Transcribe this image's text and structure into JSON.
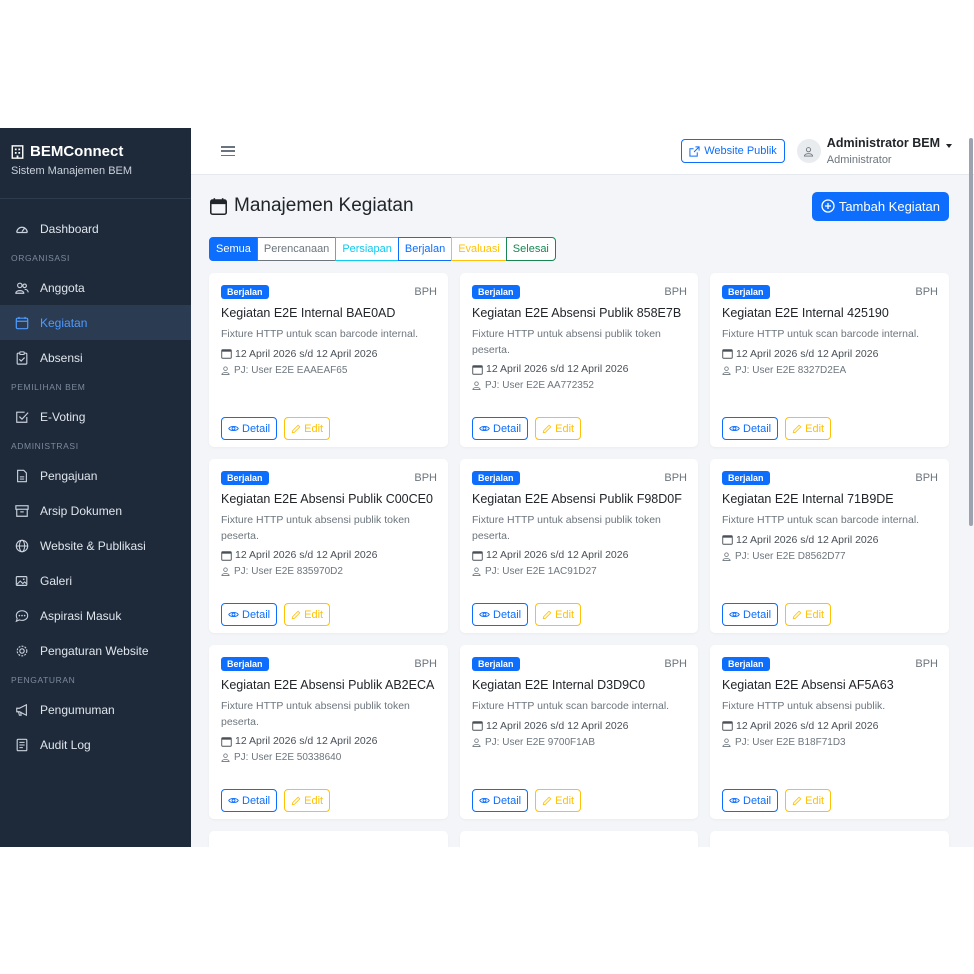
{
  "brand": {
    "name": "BEMConnect",
    "subtitle": "Sistem Manajemen BEM"
  },
  "sidebar": {
    "dashboard": "Dashboard",
    "sec_organisasi": "ORGANISASI",
    "anggota": "Anggota",
    "kegiatan": "Kegiatan",
    "absensi": "Absensi",
    "sec_pemilihan": "PEMILIHAN BEM",
    "evoting": "E-Voting",
    "sec_administrasi": "ADMINISTRASI",
    "pengajuan": "Pengajuan",
    "arsip": "Arsip Dokumen",
    "website": "Website & Publikasi",
    "galeri": "Galeri",
    "aspirasi": "Aspirasi Masuk",
    "pengaturan_web": "Pengaturan Website",
    "sec_pengaturan": "PENGATURAN",
    "pengumuman": "Pengumuman",
    "audit": "Audit Log"
  },
  "topbar": {
    "public_label": "Website Publik",
    "user_name": "Administrator BEM",
    "user_role": "Administrator"
  },
  "page": {
    "title": "Manajemen Kegiatan",
    "add_label": "Tambah Kegiatan"
  },
  "filters": [
    {
      "label": "Semua",
      "color": "#0d6efd",
      "active": true
    },
    {
      "label": "Perencanaan",
      "color": "#6c757d"
    },
    {
      "label": "Persiapan",
      "color": "#0dcaf0"
    },
    {
      "label": "Berjalan",
      "color": "#0d6efd"
    },
    {
      "label": "Evaluasi",
      "color": "#ffc107"
    },
    {
      "label": "Selesai",
      "color": "#198754"
    }
  ],
  "cards": [
    {
      "status": "Berjalan",
      "unit": "BPH",
      "title": "Kegiatan E2E Internal BAE0AD",
      "desc": "Fixture HTTP untuk scan barcode internal.",
      "date": "12 April 2026 s/d 12 April 2026",
      "pj": "PJ: User E2E EAAEAF65",
      "detail": "Detail",
      "edit": "Edit"
    },
    {
      "status": "Berjalan",
      "unit": "BPH",
      "title": "Kegiatan E2E Absensi Publik 858E7B",
      "desc": "Fixture HTTP untuk absensi publik token peserta.",
      "date": "12 April 2026 s/d 12 April 2026",
      "pj": "PJ: User E2E AA772352",
      "detail": "Detail",
      "edit": "Edit"
    },
    {
      "status": "Berjalan",
      "unit": "BPH",
      "title": "Kegiatan E2E Internal 425190",
      "desc": "Fixture HTTP untuk scan barcode internal.",
      "date": "12 April 2026 s/d 12 April 2026",
      "pj": "PJ: User E2E 8327D2EA",
      "detail": "Detail",
      "edit": "Edit"
    },
    {
      "status": "Berjalan",
      "unit": "BPH",
      "title": "Kegiatan E2E Absensi Publik C00CE0",
      "desc": "Fixture HTTP untuk absensi publik token peserta.",
      "date": "12 April 2026 s/d 12 April 2026",
      "pj": "PJ: User E2E 835970D2",
      "detail": "Detail",
      "edit": "Edit"
    },
    {
      "status": "Berjalan",
      "unit": "BPH",
      "title": "Kegiatan E2E Absensi Publik F98D0F",
      "desc": "Fixture HTTP untuk absensi publik token peserta.",
      "date": "12 April 2026 s/d 12 April 2026",
      "pj": "PJ: User E2E 1AC91D27",
      "detail": "Detail",
      "edit": "Edit"
    },
    {
      "status": "Berjalan",
      "unit": "BPH",
      "title": "Kegiatan E2E Internal 71B9DE",
      "desc": "Fixture HTTP untuk scan barcode internal.",
      "date": "12 April 2026 s/d 12 April 2026",
      "pj": "PJ: User E2E D8562D77",
      "detail": "Detail",
      "edit": "Edit"
    },
    {
      "status": "Berjalan",
      "unit": "BPH",
      "title": "Kegiatan E2E Absensi Publik AB2ECA",
      "desc": "Fixture HTTP untuk absensi publik token peserta.",
      "date": "12 April 2026 s/d 12 April 2026",
      "pj": "PJ: User E2E 50338640",
      "detail": "Detail",
      "edit": "Edit"
    },
    {
      "status": "Berjalan",
      "unit": "BPH",
      "title": "Kegiatan E2E Internal D3D9C0",
      "desc": "Fixture HTTP untuk scan barcode internal.",
      "date": "12 April 2026 s/d 12 April 2026",
      "pj": "PJ: User E2E 9700F1AB",
      "detail": "Detail",
      "edit": "Edit"
    },
    {
      "status": "Berjalan",
      "unit": "BPH",
      "title": "Kegiatan E2E Absensi AF5A63",
      "desc": "Fixture HTTP untuk absensi publik.",
      "date": "12 April 2026 s/d 12 April 2026",
      "pj": "PJ: User E2E B18F71D3",
      "detail": "Detail",
      "edit": "Edit"
    }
  ],
  "colors": {
    "sidebar_bg": "#1e2a3a",
    "primary": "#0d6efd",
    "warning": "#ffc107"
  }
}
